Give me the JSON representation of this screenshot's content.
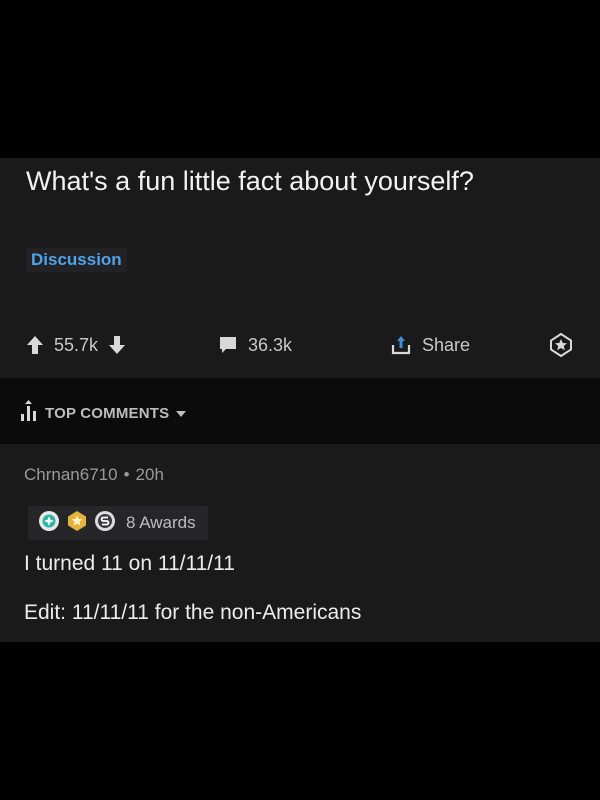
{
  "post": {
    "title": "What's a fun little fact about yourself?",
    "flair": "Discussion",
    "upvotes": "55.7k",
    "comments": "36.3k",
    "share_label": "Share"
  },
  "comments_sort": {
    "label": "TOP COMMENTS"
  },
  "comment": {
    "author": "Chrnan6710",
    "separator": "•",
    "age": "20h",
    "awards_label": "8 Awards",
    "lines": [
      "I turned 11 on 11/11/11",
      "Edit: 11/11/11 for the non-Americans"
    ]
  },
  "colors": {
    "background": "#000000",
    "card": "#1a1a1b",
    "sort_bar": "#0b0b0c",
    "flair_text": "#4fa3e6",
    "text_primary": "#f2f2f2",
    "text_secondary": "#9a9a9a"
  },
  "icons": [
    "upvote-arrow-icon",
    "downvote-arrow-icon",
    "comment-bubble-icon",
    "share-icon",
    "award-icon",
    "sort-bars-icon",
    "caret-down-icon",
    "award-badge-icons"
  ]
}
